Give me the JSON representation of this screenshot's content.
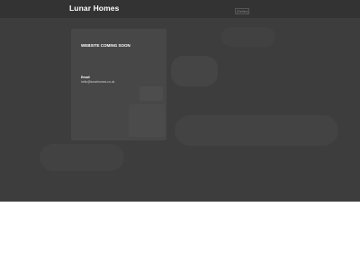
{
  "header": {
    "logo": "Lunar Homes",
    "nav_link": "[Seller]"
  },
  "card": {
    "heading": "WEBSITE COMING SOON",
    "email_label": "Email",
    "email_value": "hello@lunarhomes.co.uk"
  },
  "colors": {
    "background": "#3d3d3d",
    "header": "#333333",
    "card": "#474747",
    "text": "#ffffff"
  }
}
